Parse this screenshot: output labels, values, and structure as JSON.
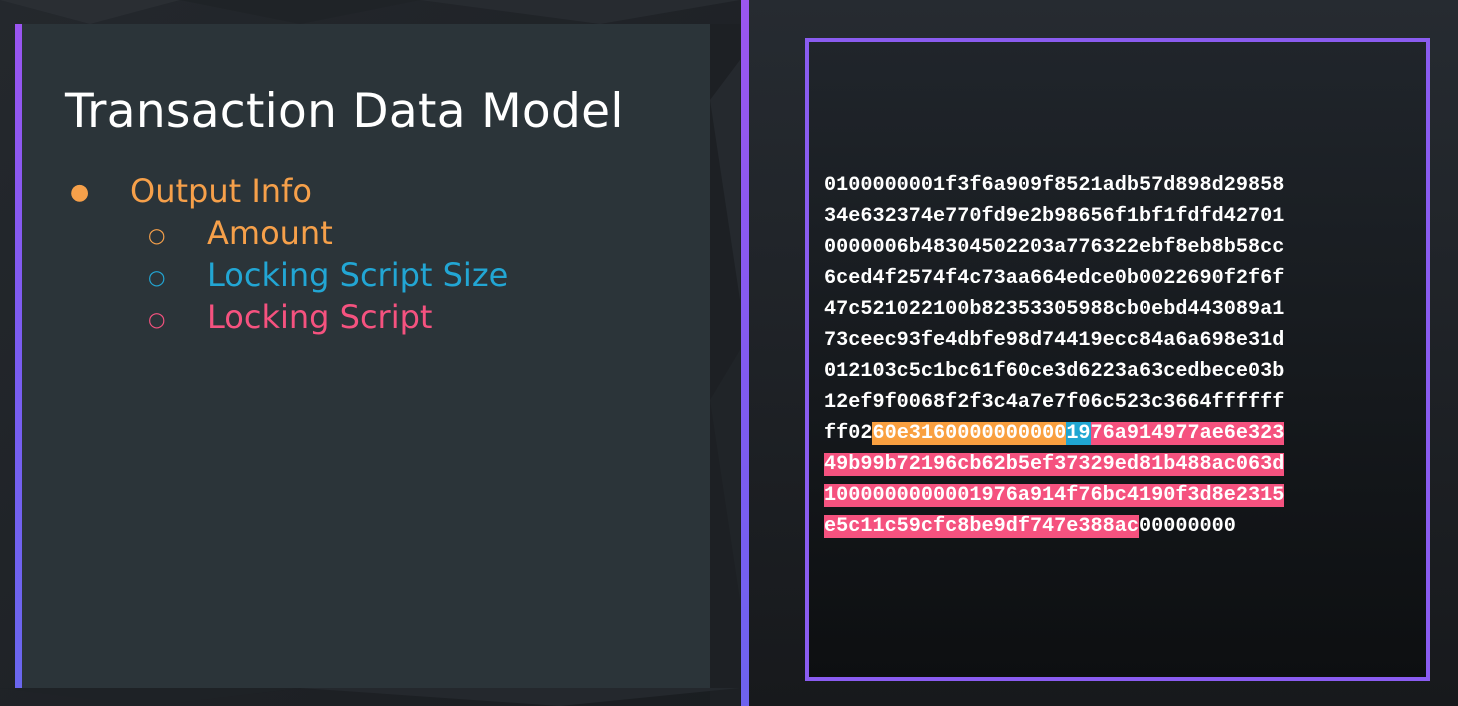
{
  "slide": {
    "title": "Transaction Data Model",
    "bullets": [
      {
        "marker": "●",
        "text": "Output Info",
        "color": "#f6a04a"
      },
      {
        "marker": "○",
        "text": "Amount",
        "color": "#f6a04a"
      },
      {
        "marker": "○",
        "text": "Locking Script Size",
        "color": "#22a6d4"
      },
      {
        "marker": "○",
        "text": "Locking Script",
        "color": "#f5527f"
      }
    ]
  },
  "hex": {
    "lines": [
      [
        {
          "t": "0100000001f3f6a909f8521adb57d898d29858",
          "c": ""
        }
      ],
      [
        {
          "t": "34e632374e770fd9e2b98656f1bf1fdfd42701",
          "c": ""
        }
      ],
      [
        {
          "t": "0000006b48304502203a776322ebf8eb8b58cc",
          "c": ""
        }
      ],
      [
        {
          "t": "6ced4f2574f4c73aa664edce0b0022690f2f6f",
          "c": ""
        }
      ],
      [
        {
          "t": "47c521022100b82353305988cb0ebd443089a1",
          "c": ""
        }
      ],
      [
        {
          "t": "73ceec93fe4dbfe98d74419ecc84a6a698e31d",
          "c": ""
        }
      ],
      [
        {
          "t": "012103c5c1bc61f60ce3d6223a63cedbece03b",
          "c": ""
        }
      ],
      [
        {
          "t": "12ef9f0068f2f3c4a7e7f06c523c3664ffffff",
          "c": ""
        }
      ],
      [
        {
          "t": "ff02",
          "c": ""
        },
        {
          "t": "60e3160000000000",
          "c": "orange"
        },
        {
          "t": "19",
          "c": "blue"
        },
        {
          "t": "76a914977ae6e323",
          "c": "pink"
        }
      ],
      [
        {
          "t": "49b99b72196cb62b5ef37329ed81b488ac063d",
          "c": "pink"
        }
      ],
      [
        {
          "t": "1000000000001976a914f76bc4190f3d8e2315",
          "c": "pink"
        }
      ],
      [
        {
          "t": "e5c11c59cfc8be9df747e388ac",
          "c": "pink"
        },
        {
          "t": "00000000",
          "c": ""
        }
      ]
    ],
    "colors": {
      "orange": "#f9a040",
      "blue": "#20a6d2",
      "pink": "#f5527f"
    }
  }
}
